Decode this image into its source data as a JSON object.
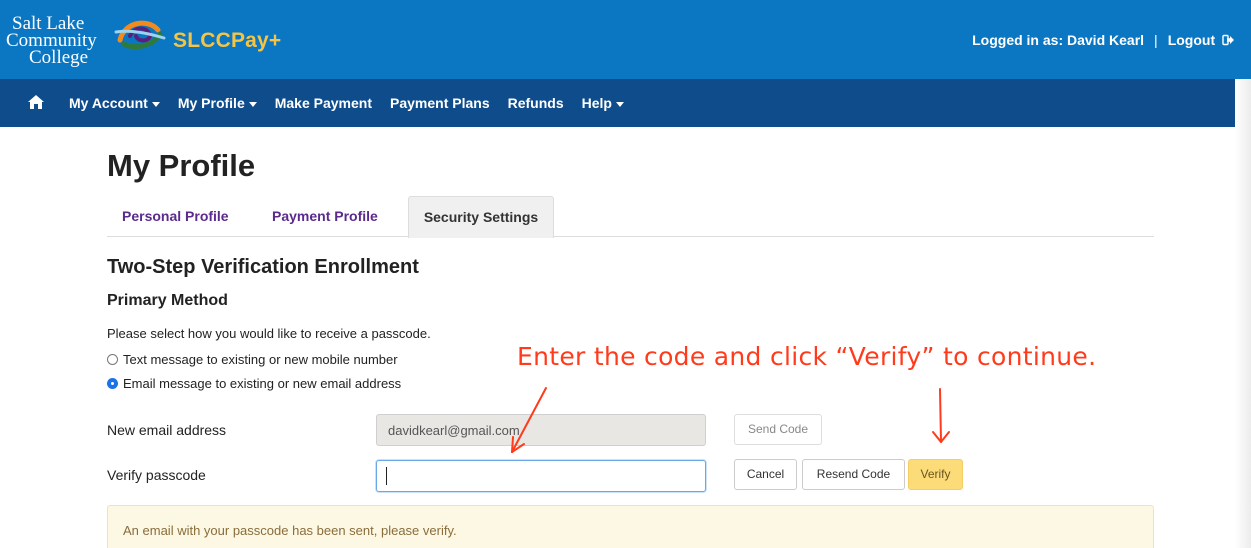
{
  "header": {
    "logo_lines": [
      "Salt Lake",
      "Community",
      "College"
    ],
    "brand": "SLCCPay+",
    "logged_in": "Logged in as: David Kearl",
    "separator": "|",
    "logout": "Logout",
    "bg_color": "#0b77c2",
    "brand_color": "#f5c445"
  },
  "nav": {
    "home_icon": "home-icon",
    "items": [
      "My Account",
      "My Profile",
      "Make Payment",
      "Payment Plans",
      "Refunds",
      "Help"
    ],
    "bg_color": "#0f4c8c"
  },
  "page": {
    "title": "My Profile",
    "tabs": [
      "Personal Profile",
      "Payment Profile",
      "Security Settings"
    ],
    "active_tab": "Security Settings"
  },
  "enrollment": {
    "heading": "Two-Step Verification Enrollment",
    "subheading": "Primary Method",
    "instruction": "Please select how you would like to receive a passcode.",
    "options": [
      "Text message to existing or new mobile number",
      "Email message to existing or new email address"
    ],
    "selected_option": "Email message to existing or new email address",
    "email_label": "New email address",
    "email_value": "davidkearl@gmail.com",
    "passcode_label": "Verify passcode",
    "passcode_value": "",
    "buttons": {
      "send": "Send Code",
      "cancel": "Cancel",
      "resend": "Resend Code",
      "verify": "Verify"
    },
    "alert": "An email with your passcode has been sent, please verify."
  },
  "annotation": {
    "text": "Enter the code and click “Verify” to continue.",
    "color": "#ff3b1c"
  }
}
